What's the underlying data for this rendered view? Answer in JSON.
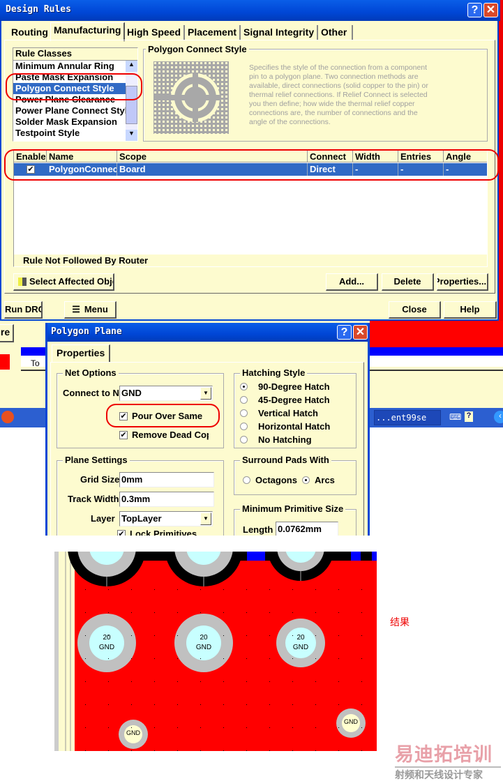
{
  "design_rules": {
    "title": "Design Rules",
    "tabs": [
      "Routing",
      "Manufacturing",
      "High Speed",
      "Placement",
      "Signal Integrity",
      "Other"
    ],
    "active_tab": "Manufacturing",
    "rule_classes": {
      "header": "Rule Classes",
      "items": [
        "Minimum Annular Ring",
        "Paste Mask Expansion",
        "Polygon Connect Style",
        "Power Plane Clearance",
        "Power Plane Connect Style",
        "Solder Mask Expansion",
        "Testpoint Style"
      ],
      "selected": "Polygon Connect Style"
    },
    "description": {
      "title": "Polygon Connect Style",
      "text": "Specifies the style of the connection from a component pin to a polygon plane. Two connection methods are available, direct connections (solid copper to the pin) or thermal relief connections. If Relief Connect is selected you then define; how wide the thermal relief copper connections are, the number of connections and the angle of the connections."
    },
    "table": {
      "columns": [
        "Enable",
        "Name",
        "Scope",
        "Connect",
        "Width",
        "Entries",
        "Angle"
      ],
      "rows": [
        {
          "enabled": true,
          "name": "PolygonConnect",
          "scope": "Board",
          "connect": "Direct",
          "width": "-",
          "entries": "-",
          "angle": "-"
        }
      ],
      "footer": "Rule Not Followed By Router"
    },
    "buttons": {
      "select_affected": "Select Affected Objects",
      "add": "Add...",
      "delete": "Delete",
      "properties": "Properties...",
      "run_drc": "Run DRC...",
      "menu": "Menu",
      "close": "Close",
      "help": "Help"
    }
  },
  "background_app": {
    "side_button": "re",
    "tab_fragment": "To",
    "taskbar_item": "...ent99se"
  },
  "polygon_plane": {
    "title": "Polygon Plane",
    "tab": "Properties",
    "net_options": {
      "label": "Net Options",
      "connect_to_label": "Connect to Net",
      "connect_to_value": "GND",
      "pour_over_same": "Pour Over Same",
      "pour_over_same_checked": true,
      "remove_dead": "Remove Dead Copper",
      "remove_dead_checked": true
    },
    "hatching_style": {
      "label": "Hatching Style",
      "options": [
        "90-Degree Hatch",
        "45-Degree Hatch",
        "Vertical Hatch",
        "Horizontal Hatch",
        "No Hatching"
      ],
      "selected": "90-Degree Hatch"
    },
    "plane_settings": {
      "label": "Plane Settings",
      "grid_size_label": "Grid Size",
      "grid_size": "0mm",
      "track_width_label": "Track Width",
      "track_width": "0.3mm",
      "layer_label": "Layer",
      "layer": "TopLayer",
      "lock_primitives": "Lock Primitives",
      "lock_checked": true
    },
    "surround_pads": {
      "label": "Surround Pads With",
      "options": [
        "Octagons",
        "Arcs"
      ],
      "selected": "Arcs"
    },
    "min_primitive": {
      "label": "Minimum Primitive Size",
      "length_label": "Length",
      "length": "0.0762mm"
    }
  },
  "pcb_result": {
    "pads": [
      {
        "num": "20",
        "net": "GND"
      },
      {
        "num": "20",
        "net": "GND"
      },
      {
        "num": "20",
        "net": "GND"
      }
    ],
    "small_pads": [
      "GND",
      "GND"
    ],
    "colors": {
      "plane": "#ff0000",
      "clearance": "#000000",
      "pad": "#c0c0c0",
      "hole": "#c8ffff"
    }
  },
  "caption": "结果",
  "watermark": {
    "brand": "易迪拓培训",
    "tagline": "射频和天线设计专家"
  }
}
